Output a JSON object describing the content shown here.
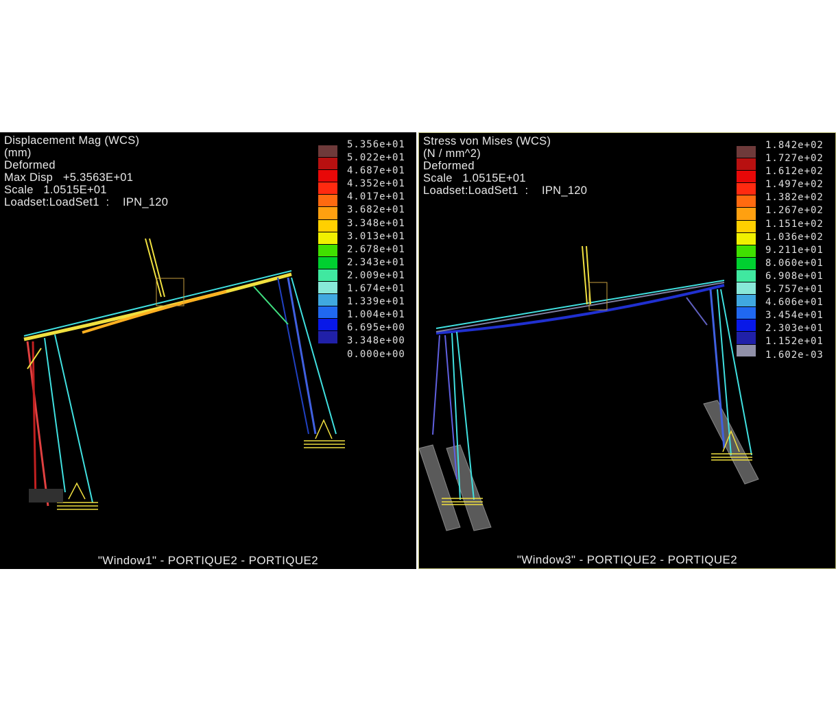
{
  "window1": {
    "header": [
      "Displacement Mag (WCS)",
      "(mm)",
      "Deformed",
      "Max Disp   +5.3563E+01",
      "Scale   1.0515E+01",
      "Loadset:LoadSet1  :    IPN_120"
    ],
    "legend_values": [
      "5.356e+01",
      "5.022e+01",
      "4.687e+01",
      "4.352e+01",
      "4.017e+01",
      "3.682e+01",
      "3.348e+01",
      "3.013e+01",
      "2.678e+01",
      "2.343e+01",
      "2.009e+01",
      "1.674e+01",
      "1.339e+01",
      "1.004e+01",
      "6.695e+00",
      "3.348e+00",
      "0.000e+00"
    ],
    "legend_colors": [
      "#6e3a3a",
      "#b81010",
      "#e80808",
      "#ff2a10",
      "#ff6a10",
      "#ffa010",
      "#ffd000",
      "#f0f000",
      "#40e000",
      "#00d030",
      "#40e8a0",
      "#88e8d8",
      "#40a8e0",
      "#2068f0",
      "#0818e8",
      "#2020a8"
    ],
    "footer": "\"Window1\" - PORTIQUE2 - PORTIQUE2"
  },
  "window3": {
    "header": [
      "Stress von Mises (WCS)",
      "(N / mm^2)",
      "Deformed",
      "Scale   1.0515E+01",
      "Loadset:LoadSet1  :    IPN_120"
    ],
    "legend_values": [
      "1.842e+02",
      "1.727e+02",
      "1.612e+02",
      "1.497e+02",
      "1.382e+02",
      "1.267e+02",
      "1.151e+02",
      "1.036e+02",
      "9.211e+01",
      "8.060e+01",
      "6.908e+01",
      "5.757e+01",
      "4.606e+01",
      "3.454e+01",
      "2.303e+01",
      "1.152e+01",
      "1.602e-03"
    ],
    "legend_colors": [
      "#6e3a3a",
      "#b81010",
      "#e80808",
      "#ff2a10",
      "#ff6a10",
      "#ffa010",
      "#ffd000",
      "#f0f000",
      "#40e000",
      "#00d030",
      "#40e8a0",
      "#88e8d8",
      "#40a8e0",
      "#2068f0",
      "#0818e8",
      "#2020a8",
      "#9090a8"
    ],
    "footer": "\"Window3\" - PORTIQUE2 - PORTIQUE2"
  }
}
